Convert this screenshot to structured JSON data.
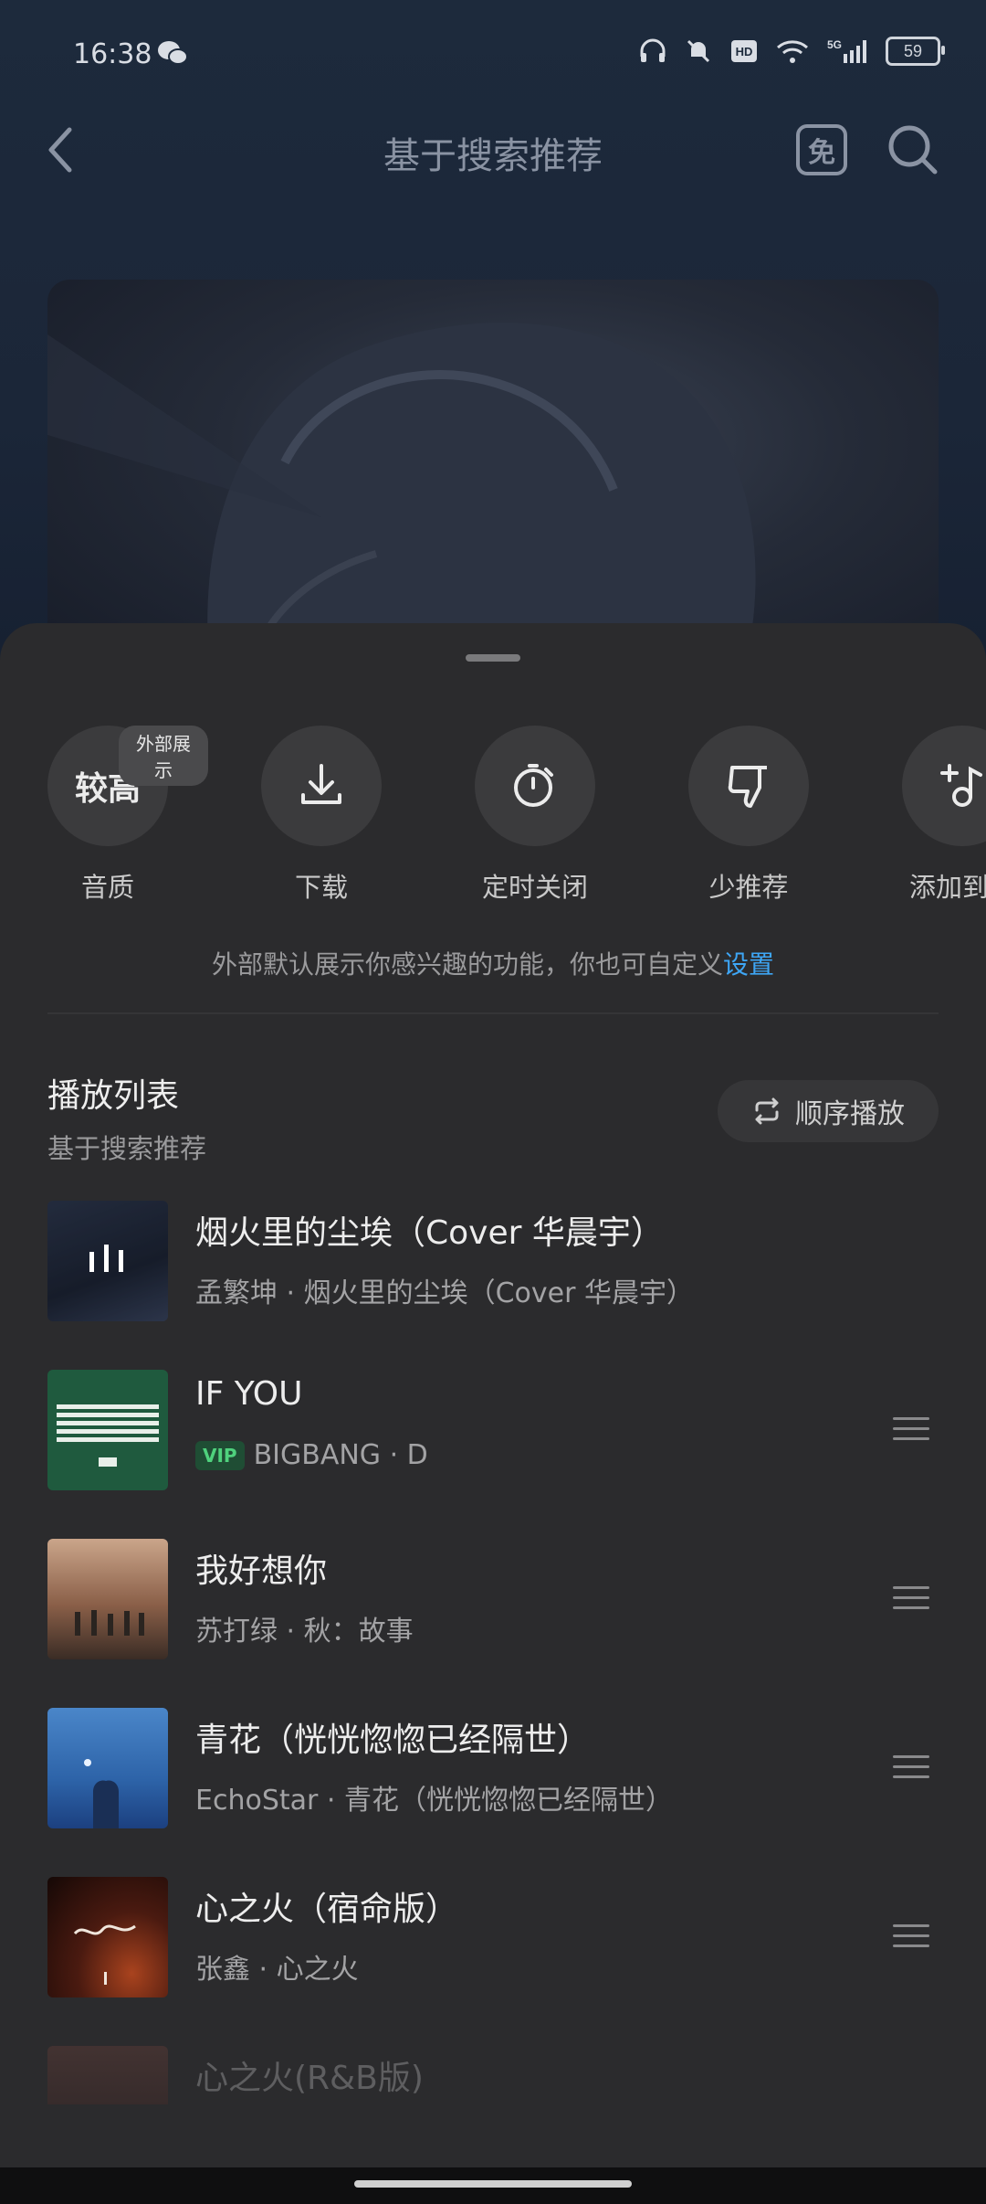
{
  "status_bar": {
    "time": "16:38",
    "battery": "59"
  },
  "topbar": {
    "title": "基于搜索推荐",
    "free_label": "免"
  },
  "actions": [
    {
      "label": "音质",
      "circle_text": "较高",
      "badge": "外部展示",
      "icon": "quality-text"
    },
    {
      "label": "下载",
      "icon": "download-icon"
    },
    {
      "label": "定时关闭",
      "icon": "timer-icon"
    },
    {
      "label": "少推荐",
      "icon": "thumbs-down-icon"
    },
    {
      "label": "添加到歌",
      "icon": "add-to-playlist-icon"
    }
  ],
  "hint": {
    "text": "外部默认展示你感兴趣的功能，你也可自定义",
    "link": "设置"
  },
  "playlist": {
    "title": "播放列表",
    "subtitle": "基于搜索推荐",
    "order_button": "顺序播放"
  },
  "songs": [
    {
      "name": "烟火里的尘埃（Cover 华晨宇）",
      "meta": "孟繁坤 · 烟火里的尘埃（Cover 华晨宇）",
      "vip": false,
      "playing": true
    },
    {
      "name": "IF YOU",
      "meta": "BIGBANG · D",
      "vip": true,
      "vip_label": "VIP"
    },
    {
      "name": "我好想你",
      "meta": "苏打绿 · 秋：故事",
      "vip": false
    },
    {
      "name": "青花（恍恍惚惚已经隔世）",
      "meta": "EchoStar · 青花（恍恍惚惚已经隔世）",
      "vip": false
    },
    {
      "name": "心之火（宿命版）",
      "meta": "张鑫 · 心之火",
      "vip": false
    },
    {
      "name": "心之火(R&B版)",
      "meta": "",
      "vip": false
    }
  ],
  "colors": {
    "accent_link": "#3ea6f5",
    "sheet_bg": "#2b2b2d",
    "vip_green": "#4fd17d"
  }
}
